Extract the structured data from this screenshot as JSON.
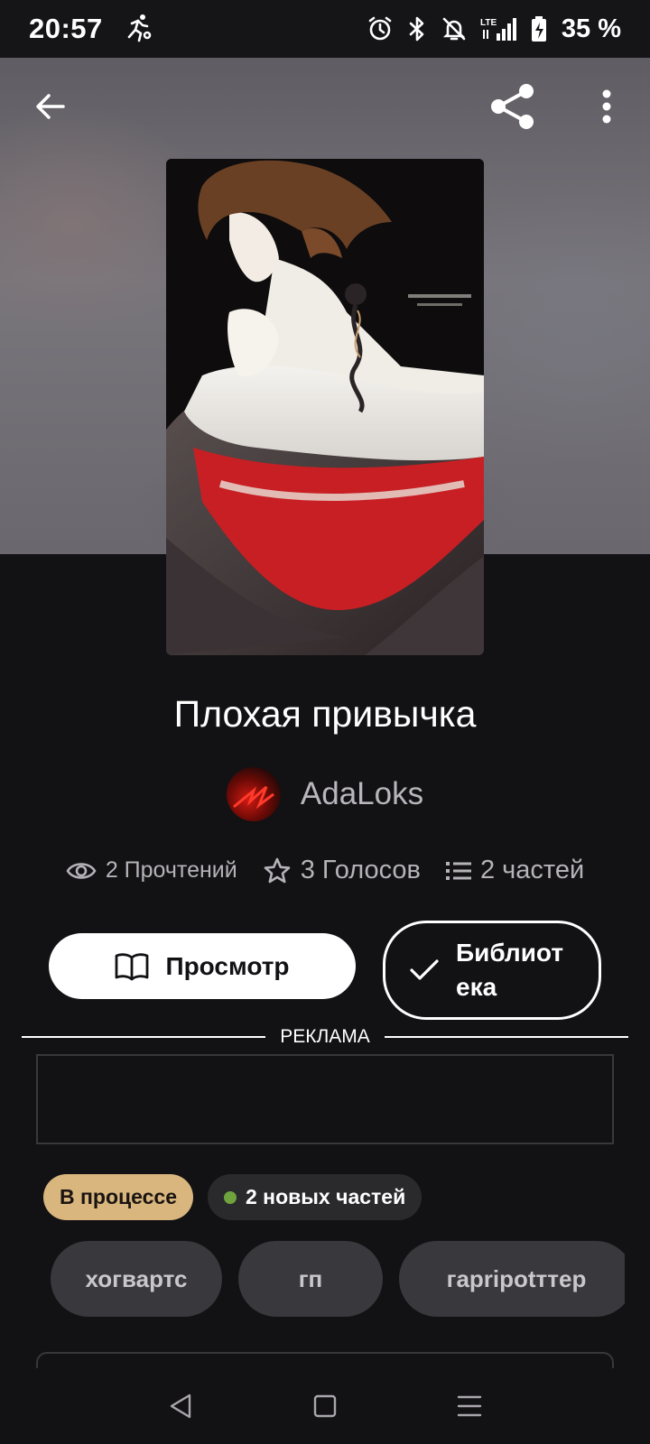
{
  "status_bar": {
    "time": "20:57",
    "battery_percent": "35 %",
    "network": "LTE"
  },
  "book": {
    "title": "Плохая привычка",
    "author": "AdaLoks",
    "stats": {
      "reads": "2 Прочтений",
      "votes": "3 Голосов",
      "parts": "2 частей"
    }
  },
  "actions": {
    "view_label": "Просмотр",
    "library_label": "Библиотека"
  },
  "ad": {
    "label": "РЕКЛАМА"
  },
  "badges": {
    "status": "В процессе",
    "new_parts": "2 новых частей"
  },
  "tags": [
    "хогвартс",
    "гп",
    "гарripotттер"
  ],
  "colors": {
    "background": "#121114",
    "status_badge": "#d8b67e",
    "new_dot": "#6fa33e",
    "tag_bg": "#39383c"
  },
  "icons": {
    "back": "arrow-left-icon",
    "share": "share-icon",
    "more": "more-vertical-icon",
    "reads": "eye-icon",
    "votes": "star-icon",
    "parts": "list-icon",
    "view": "book-open-icon",
    "library": "check-icon"
  }
}
